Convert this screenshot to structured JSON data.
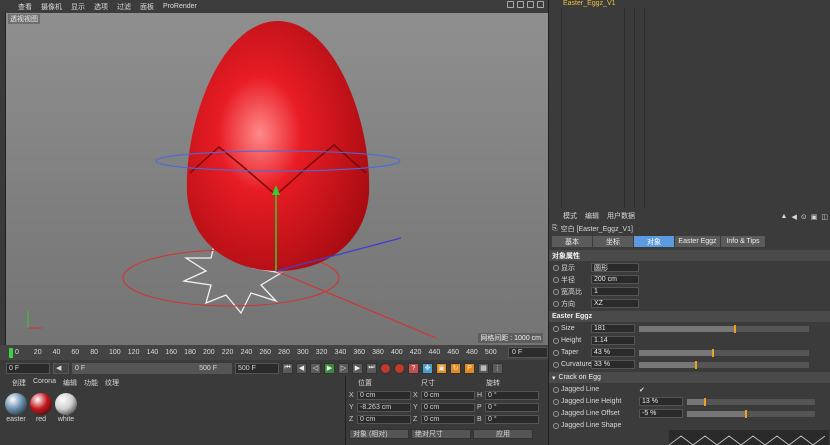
{
  "viewport": {
    "menu": [
      "查看",
      "摄像机",
      "显示",
      "选项",
      "过滤",
      "面板",
      "ProRender"
    ],
    "label": "透视视图",
    "grid_spacing": "网格间距 : 1000 cm"
  },
  "object_manager": {
    "object_name": "Easter_Eggz_V1"
  },
  "attributes": {
    "menu": [
      "模式",
      "编辑",
      "用户数据"
    ],
    "object_line": "空白 [Easter_Eggz_V1]",
    "tabs": [
      "基本",
      "坐标",
      "对象",
      "Easter Eggz",
      "Info & Tips"
    ],
    "active_tab": "对象",
    "section_object": "对象属性",
    "display_label": "显示",
    "display_value": "圆形",
    "radius_label": "半径",
    "radius_value": "200 cm",
    "aspect_label": "宽高比",
    "aspect_value": "1",
    "orient_label": "方向",
    "orient_value": "XZ",
    "section_egg": "Easter Eggz",
    "size_label": "Size",
    "size_value": "181",
    "size_fraction": 0.56,
    "height_label": "Height",
    "height_value": "1.14",
    "height_fraction": 0.0,
    "taper_label": "Taper",
    "taper_value": "43 %",
    "taper_fraction": 0.43,
    "curv_label": "Curvature",
    "curv_value": "33 %",
    "curv_fraction": 0.33,
    "crack_label": "Crack on Egg",
    "jagged_line_label": "Jagged Line",
    "jagged_line_check": "✔",
    "jlh_label": "Jagged Line Height",
    "jlh_value": "13 %",
    "jlh_fraction": 0.13,
    "jlo_label": "Jagged Line Offset",
    "jlo_value": "-5 %",
    "jlo_fraction": 0.45,
    "jls_label": "Jagged Line Shape"
  },
  "timeline": {
    "ticks": [
      "0",
      "20",
      "40",
      "60",
      "80",
      "100",
      "120",
      "140",
      "160",
      "180",
      "200",
      "220",
      "240",
      "260",
      "280",
      "300",
      "320",
      "340",
      "360",
      "380",
      "400",
      "420",
      "440",
      "460",
      "480",
      "500"
    ],
    "current": "0 F"
  },
  "transport": {
    "start": "0 F",
    "min": "0 F",
    "max": "500 F",
    "end": "500 F"
  },
  "materials": {
    "menu": [
      "创建",
      "Corona",
      "编辑",
      "功能",
      "纹理"
    ],
    "items": [
      {
        "name": "easter",
        "color": "#6a8fb0"
      },
      {
        "name": "red",
        "color": "#c4161c"
      },
      {
        "name": "white",
        "color": "#d0d0d0"
      }
    ]
  },
  "coordinates": {
    "headers": [
      "位置",
      "尺寸",
      "旋转"
    ],
    "pos": [
      {
        "axis": "X",
        "value": "0 cm"
      },
      {
        "axis": "Y",
        "value": "-8.263 cm"
      },
      {
        "axis": "Z",
        "value": "0 cm"
      }
    ],
    "size": [
      "0 cm",
      "0 cm",
      "0 cm"
    ],
    "rot": [
      {
        "axis": "H",
        "value": "0 °"
      },
      {
        "axis": "P",
        "value": "0 °"
      },
      {
        "axis": "B",
        "value": "0 °"
      }
    ],
    "mode": "对象 (相对)",
    "size_mode": "绝对尺寸",
    "apply": "应用"
  }
}
